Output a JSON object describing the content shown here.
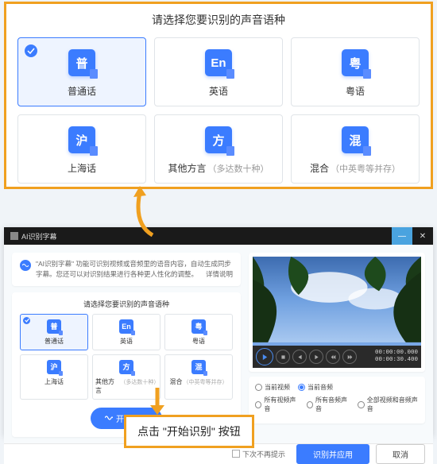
{
  "top": {
    "title": "请选择您要识别的声音语种",
    "items": [
      {
        "glyph": "普",
        "label": "普通话",
        "hint": "",
        "selected": true
      },
      {
        "glyph": "En",
        "label": "英语",
        "hint": "",
        "selected": false
      },
      {
        "glyph": "粤",
        "label": "粤语",
        "hint": "",
        "selected": false
      },
      {
        "glyph": "沪",
        "label": "上海话",
        "hint": "",
        "selected": false
      },
      {
        "glyph": "方",
        "label": "其他方言",
        "hint": "（多达数十种）",
        "selected": false
      },
      {
        "glyph": "混",
        "label": "混合",
        "hint": "（中英粤等并存）",
        "selected": false
      }
    ]
  },
  "app": {
    "title": "AI识别字幕",
    "info_text": "\"AI识别字幕\" 功能可识别视频或音频里的语音内容，自动生成同步字幕。您还可以对识别结果进行各种更人性化的调整。",
    "info_link": "详情说明",
    "lang_title": "请选择您要识别的声音语种",
    "lang_items": [
      {
        "glyph": "普",
        "label": "普通话",
        "hint": "",
        "selected": true
      },
      {
        "glyph": "En",
        "label": "英语",
        "hint": "",
        "selected": false
      },
      {
        "glyph": "粤",
        "label": "粤语",
        "hint": "",
        "selected": false
      },
      {
        "glyph": "沪",
        "label": "上海话",
        "hint": "",
        "selected": false
      },
      {
        "glyph": "方",
        "label": "其他方言",
        "hint": "（多达数十种）",
        "selected": false
      },
      {
        "glyph": "混",
        "label": "混合",
        "hint": "（中英粤等并存）",
        "selected": false
      }
    ],
    "start_label": "开始识别",
    "timecode_a": "00:00:00.000",
    "timecode_b": "00:00:30.400",
    "options_row1": [
      {
        "label": "当前视频",
        "checked": false
      },
      {
        "label": "当前音频",
        "checked": true
      }
    ],
    "options_row2": [
      {
        "label": "所有视频声音",
        "checked": false
      },
      {
        "label": "所有音频声音",
        "checked": false
      },
      {
        "label": "全部视频和音频声音",
        "checked": false
      }
    ],
    "hint_checkbox": "下次不再提示",
    "apply_label": "识别并应用",
    "cancel_label": "取消"
  },
  "callout": "点击 \"开始识别\" 按钮"
}
